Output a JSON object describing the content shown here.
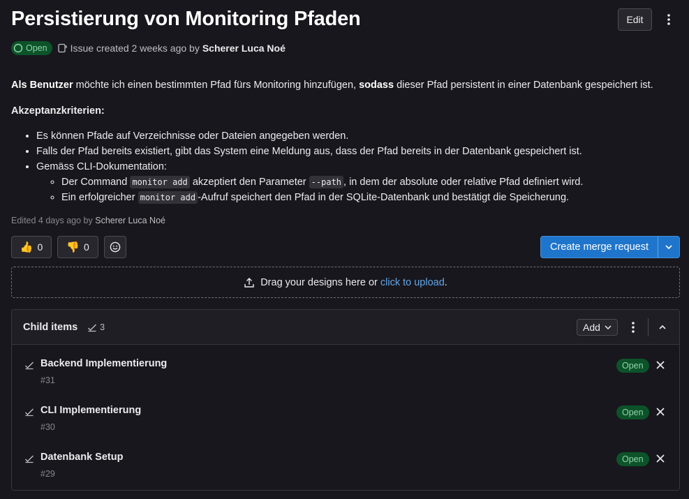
{
  "issue": {
    "title": "Persistierung von Monitoring Pfaden",
    "status": "Open",
    "created_text": "Issue created 2 weeks ago by",
    "author": "Scherer Luca Noé",
    "edit_label": "Edit"
  },
  "description": {
    "intro_bold": "Als Benutzer",
    "intro_mid": " möchte ich einen bestimmten Pfad fürs Monitoring hinzufügen, ",
    "intro_bold2": "sodass",
    "intro_end": " dieser Pfad persistent in einer Datenbank gespeichert ist.",
    "criteria_heading": "Akzeptanzkriterien:",
    "bullet_1": "Es können Pfade auf Verzeichnisse oder Dateien angegeben werden.",
    "bullet_2": "Falls der Pfad bereits existiert, gibt das System eine Meldung aus, dass der Pfad bereits in der Datenbank gespeichert ist.",
    "bullet_3": "Gemäss CLI-Dokumentation:",
    "sub_1_a": "Der Command ",
    "sub_1_code1": "monitor add",
    "sub_1_b": " akzeptiert den Parameter ",
    "sub_1_code2": "--path",
    "sub_1_c": ", in dem der absolute oder relative Pfad definiert wird.",
    "sub_2_a": "Ein erfolgreicher ",
    "sub_2_code": "monitor add",
    "sub_2_b": "-Aufruf speichert den Pfad in der SQLite-Datenbank und bestätigt die Speicherung."
  },
  "edited": {
    "prefix": "Edited 4 days ago by",
    "name": "Scherer Luca Noé"
  },
  "reactions": {
    "thumbs_up_count": "0",
    "thumbs_down_count": "0"
  },
  "merge_request_label": "Create merge request",
  "dropzone": {
    "text": "Drag your designs here or ",
    "link": "click to upload",
    "end": "."
  },
  "child_items": {
    "title": "Child items",
    "count": "3",
    "add_label": "Add",
    "items": [
      {
        "name": "Backend Implementierung",
        "ref": "#31",
        "status": "Open"
      },
      {
        "name": "CLI Implementierung",
        "ref": "#30",
        "status": "Open"
      },
      {
        "name": "Datenbank Setup",
        "ref": "#29",
        "status": "Open"
      }
    ]
  },
  "colors": {
    "background": "#18171d",
    "primary": "#1f75cb",
    "status_green": "#0d532a",
    "link": "#63a6e9"
  }
}
